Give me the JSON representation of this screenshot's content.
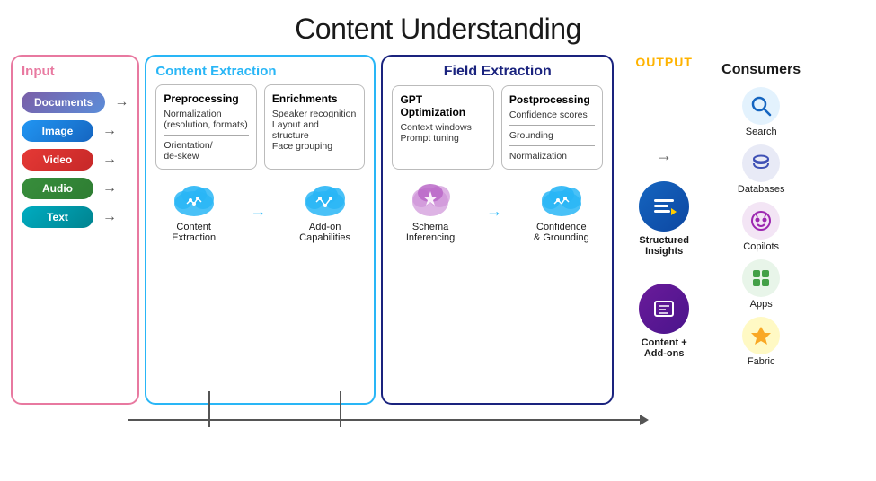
{
  "title": "Content Understanding",
  "input": {
    "label": "Input",
    "items": [
      {
        "id": "documents",
        "label": "Documents",
        "class": "badge-documents"
      },
      {
        "id": "image",
        "label": "Image",
        "class": "badge-image"
      },
      {
        "id": "video",
        "label": "Video",
        "class": "badge-video"
      },
      {
        "id": "audio",
        "label": "Audio",
        "class": "badge-audio"
      },
      {
        "id": "text",
        "label": "Text",
        "class": "badge-text"
      }
    ]
  },
  "content_extraction": {
    "label": "Content Extraction",
    "preprocessing": {
      "title": "Preprocessing",
      "line1": "Normalization",
      "line2": "(resolution, formats)",
      "line3": "Orientation/",
      "line4": "de-skew"
    },
    "enrichments": {
      "title": "Enrichments",
      "line1": "Speaker recognition",
      "line2": "Layout and structure",
      "line3": "Face grouping"
    },
    "cloud1": {
      "label": "Content\nExtraction"
    },
    "cloud2": {
      "label": "Add-on\nCapabilities"
    }
  },
  "field_extraction": {
    "label": "Field Extraction",
    "gpt": {
      "title": "GPT Optimization",
      "line1": "Context windows",
      "line2": "Prompt tuning"
    },
    "postprocessing": {
      "title": "Postprocessing",
      "line1": "Confidence scores",
      "line2": "Grounding",
      "line3": "Normalization"
    },
    "cloud1_label": "Schema\nInferencing",
    "cloud2_label": "Confidence\n& Grounding"
  },
  "output": {
    "label": "OUTPUT",
    "item1": {
      "label": "Structured\nInsights"
    },
    "item2": {
      "label": "Content +\nAdd-ons"
    }
  },
  "consumers": {
    "label": "Consumers",
    "items": [
      {
        "id": "search",
        "label": "Search",
        "icon": "🔍"
      },
      {
        "id": "databases",
        "label": "Databases",
        "icon": "🗄"
      },
      {
        "id": "copilots",
        "label": "Copilots",
        "icon": "🤖"
      },
      {
        "id": "apps",
        "label": "Apps",
        "icon": "📱"
      },
      {
        "id": "fabric",
        "label": "Fabric",
        "icon": "⚡"
      }
    ]
  }
}
